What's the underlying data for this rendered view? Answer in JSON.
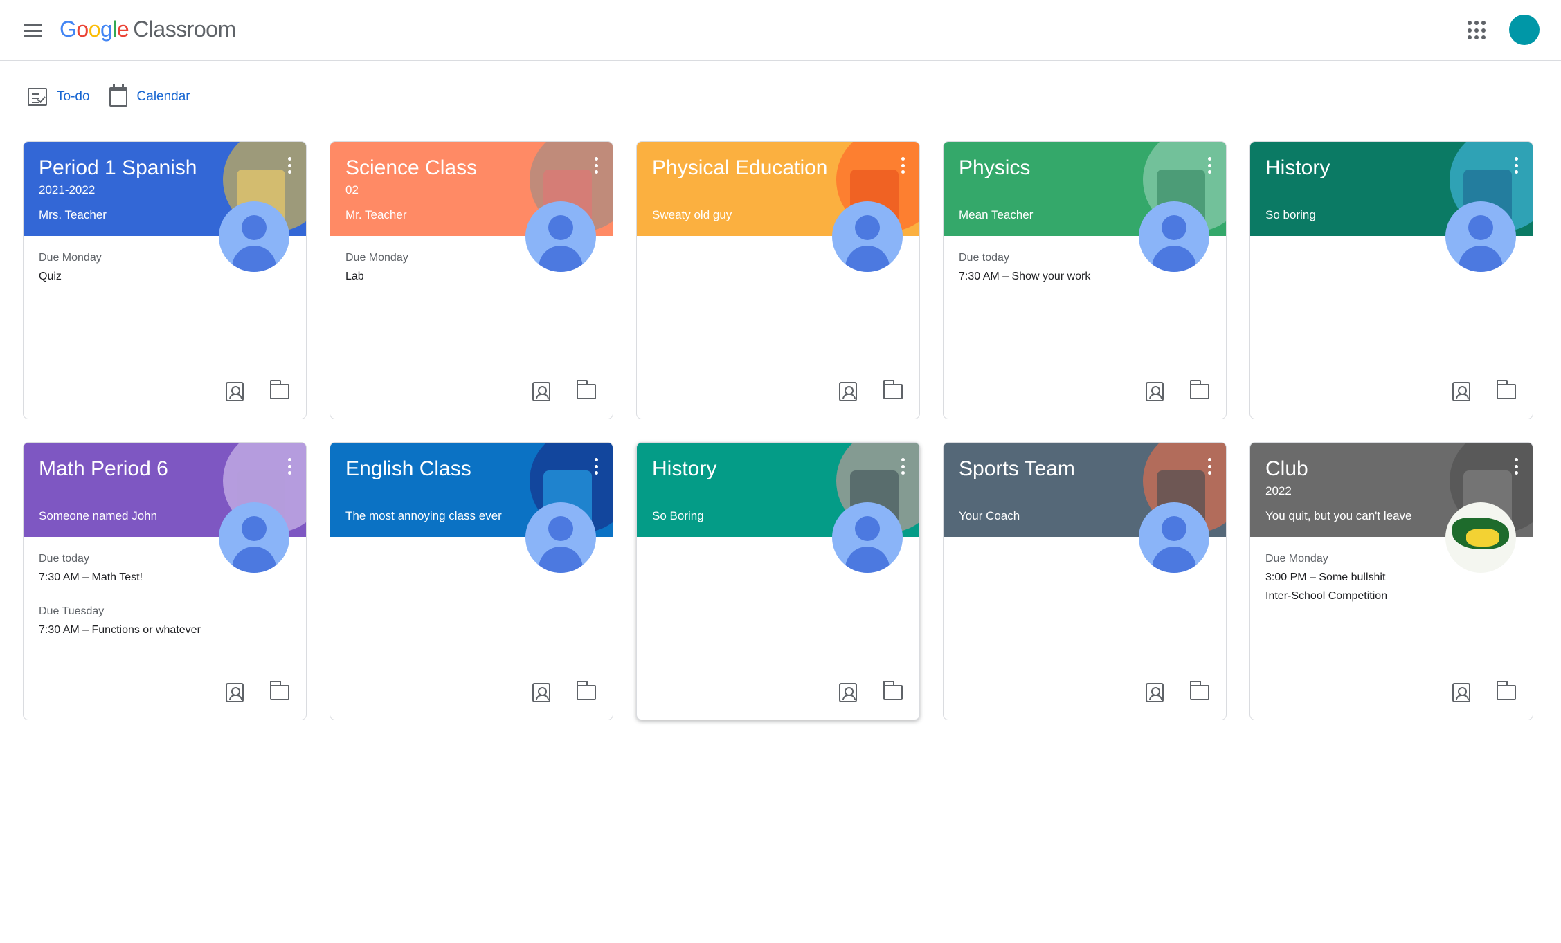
{
  "header": {
    "brand_letters": [
      "G",
      "o",
      "o",
      "g",
      "l",
      "e"
    ],
    "product": "Classroom"
  },
  "subnav": {
    "todo": "To-do",
    "calendar": "Calendar"
  },
  "colors": {
    "accent": "#1967d2",
    "avatar": "#0097a7"
  },
  "classes": [
    {
      "name": "Period 1 Spanish",
      "section": "2021-2022",
      "teacher": "Mrs. Teacher",
      "color": "#3367d6",
      "due": [
        {
          "label": "Due Monday",
          "item": "Quiz"
        }
      ]
    },
    {
      "name": "Science Class",
      "section": "02",
      "teacher": "Mr. Teacher",
      "color": "#ff8a65",
      "due": [
        {
          "label": "Due Monday",
          "item": "Lab"
        }
      ]
    },
    {
      "name": "Physical Education",
      "section": "",
      "teacher": "Sweaty old guy",
      "color": "#fbb040",
      "due": []
    },
    {
      "name": "Physics",
      "section": "",
      "teacher": "Mean Teacher",
      "color": "#34a86a",
      "due": [
        {
          "label": "Due today",
          "item": "7:30 AM – Show your work"
        }
      ]
    },
    {
      "name": "History",
      "section": "",
      "teacher": "So boring",
      "color": "#0b7a64",
      "due": []
    },
    {
      "name": "Math Period 6",
      "section": "",
      "teacher": "Someone named John",
      "color": "#7e57c2",
      "due": [
        {
          "label": "Due today",
          "item": "7:30 AM – Math Test!"
        },
        {
          "label": "Due Tuesday",
          "item": "7:30 AM – Functions or whatever"
        }
      ]
    },
    {
      "name": "English Class",
      "section": "",
      "teacher": "The most annoying class ever",
      "color": "#0b72c4",
      "due": []
    },
    {
      "name": "History",
      "section": "",
      "teacher": "So Boring",
      "color": "#049c87",
      "due": []
    },
    {
      "name": "Sports Team",
      "section": "",
      "teacher": "Your Coach",
      "color": "#556878",
      "due": []
    },
    {
      "name": "Club",
      "section": "2022",
      "teacher": "You quit, but you can't leave",
      "color": "#6b6b6b",
      "due": [
        {
          "label": "Due Monday",
          "item": "3:00 PM – Some bullshit"
        },
        {
          "label": "",
          "item": "Inter-School Competition"
        }
      ]
    }
  ]
}
